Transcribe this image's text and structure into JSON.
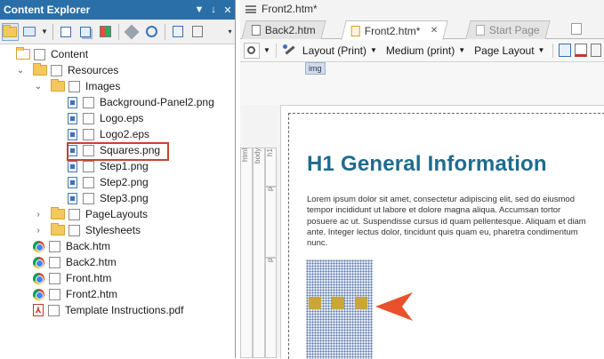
{
  "left_panel": {
    "title": "Content Explorer",
    "controls": [
      "▼",
      "↓",
      "✕"
    ],
    "tree": [
      {
        "label": "Content",
        "depth": 0,
        "expander": "",
        "icon": "content-icon"
      },
      {
        "label": "Resources",
        "depth": 1,
        "expander": "⌄",
        "icon": "folder-icon"
      },
      {
        "label": "Images",
        "depth": 2,
        "expander": "⌄",
        "icon": "folder-icon"
      },
      {
        "label": "Background-Panel2.png",
        "depth": 3,
        "expander": "",
        "icon": "image-file-icon"
      },
      {
        "label": "Logo.eps",
        "depth": 3,
        "expander": "",
        "icon": "image-file-icon"
      },
      {
        "label": "Logo2.eps",
        "depth": 3,
        "expander": "",
        "icon": "image-file-icon"
      },
      {
        "label": "Squares.png",
        "depth": 3,
        "expander": "",
        "icon": "image-file-icon",
        "selected": true
      },
      {
        "label": "Step1.png",
        "depth": 3,
        "expander": "",
        "icon": "image-file-icon"
      },
      {
        "label": "Step2.png",
        "depth": 3,
        "expander": "",
        "icon": "image-file-icon"
      },
      {
        "label": "Step3.png",
        "depth": 3,
        "expander": "",
        "icon": "image-file-icon"
      },
      {
        "label": "PageLayouts",
        "depth": 2,
        "expander": "›",
        "icon": "folder-icon"
      },
      {
        "label": "Stylesheets",
        "depth": 2,
        "expander": "›",
        "icon": "folder-icon"
      },
      {
        "label": "Back.htm",
        "depth": 1,
        "expander": "",
        "icon": "chrome-icon"
      },
      {
        "label": "Back2.htm",
        "depth": 1,
        "expander": "",
        "icon": "chrome-icon"
      },
      {
        "label": "Front.htm",
        "depth": 1,
        "expander": "",
        "icon": "chrome-icon"
      },
      {
        "label": "Front2.htm",
        "depth": 1,
        "expander": "",
        "icon": "chrome-icon"
      },
      {
        "label": "Template Instructions.pdf",
        "depth": 1,
        "expander": "",
        "icon": "pdf-icon"
      }
    ]
  },
  "editor": {
    "window_title": "Front2.htm*",
    "tabs": [
      {
        "label": "Back2.htm",
        "state": "normal"
      },
      {
        "label": "Front2.htm*",
        "state": "active"
      },
      {
        "label": "Start Page",
        "state": "inactive"
      }
    ],
    "toolbar": {
      "layout": "Layout (Print)",
      "medium": "Medium (print)",
      "page_layout": "Page Layout"
    },
    "tag_label": "img",
    "structure_bars": [
      "html",
      "body",
      "h1",
      "p",
      "p"
    ],
    "heading": "H1 General Information",
    "paragraph": "Lorem ipsum dolor sit amet, consectetur adipiscing elit, sed do eiusmod tempor incididunt ut labore et dolore magna aliqua. Accumsan tortor posuere ac ut. Suspendisse cursus id quam pellentesque. Aliquam et diam ante. Integer lectus dolor, tincidunt quis quam eu, pharetra condimentum nunc.",
    "colors": {
      "heading": "#1f6b8e",
      "arrow": "#e8512b",
      "highlight": "#c8432f",
      "title_bar": "#2b6fa8"
    }
  }
}
